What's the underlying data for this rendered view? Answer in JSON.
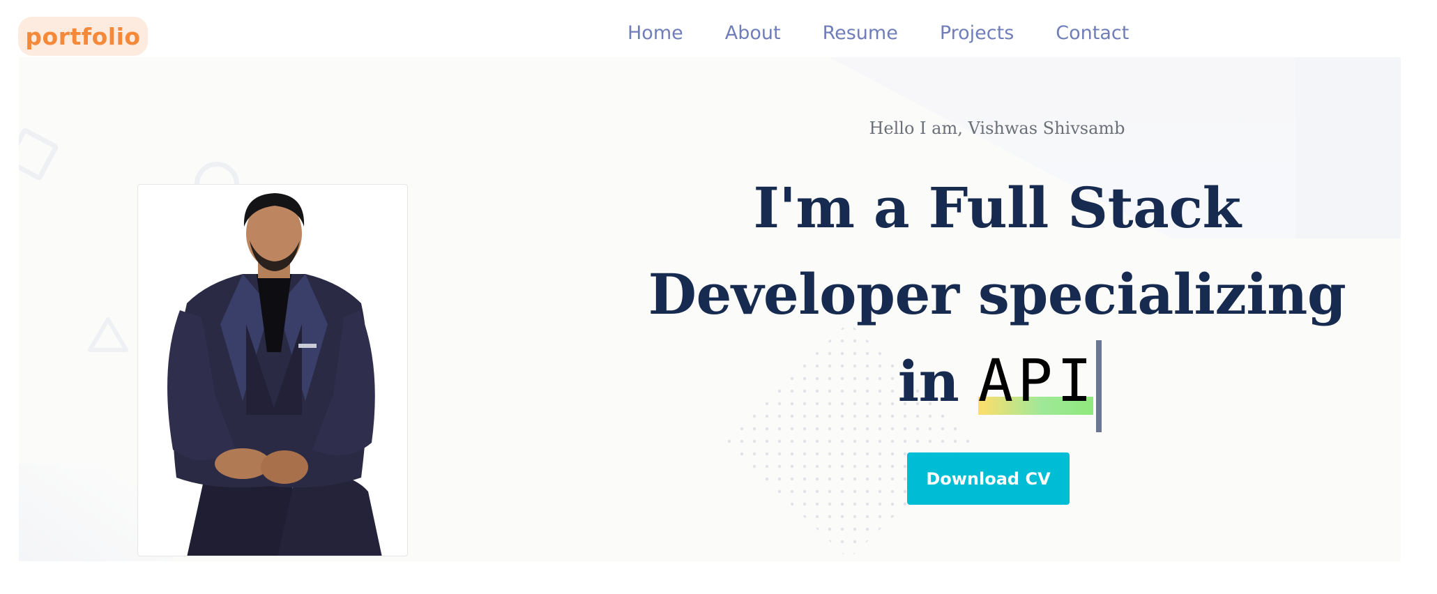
{
  "header": {
    "logo_text": "portfolio",
    "nav": [
      {
        "label": "Home"
      },
      {
        "label": "About"
      },
      {
        "label": "Resume"
      },
      {
        "label": "Projects"
      },
      {
        "label": "Contact"
      }
    ]
  },
  "hero": {
    "greeting": "Hello I am, Vishwas Shivsamb",
    "headline_line1": "I'm a Full Stack",
    "headline_line2": "Developer specializing",
    "headline_line3_prefix": "in ",
    "typed_word": "API",
    "cta_label": "Download CV"
  },
  "colors": {
    "logo_accent": "#f5893a",
    "logo_background": "#fdebdf",
    "nav_text": "#6f7eb8",
    "headline": "#172a4f",
    "cta_background": "#00bdd6",
    "highlight_start": "#ffde6b",
    "highlight_end": "#8fe97c"
  },
  "icons": {
    "decorations": [
      "rounded-square-outline-icon",
      "circle-outline-icon",
      "triangle-outline-icon",
      "dot-grid-pattern"
    ]
  }
}
